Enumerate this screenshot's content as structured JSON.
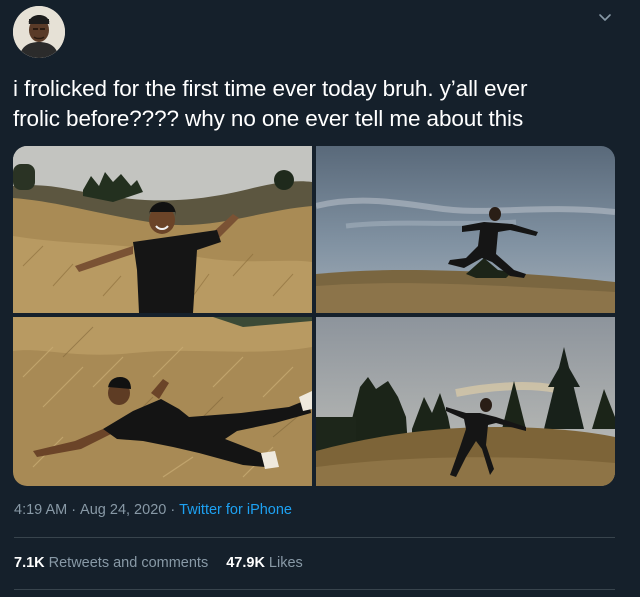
{
  "tweet": {
    "text_line1": "i frolicked for the first time ever today bruh. y’all ever",
    "text_line2": "frolic before???? why no one ever tell me about this",
    "time": "4:19 AM",
    "date": "Aug 24, 2020",
    "separator": "·",
    "source": "Twitter for iPhone"
  },
  "stats": {
    "retweets_count": "7.1K",
    "retweets_label": "Retweets and comments",
    "likes_count": "47.9K",
    "likes_label": "Likes"
  },
  "icons": {
    "menu": "chevron-down-icon",
    "avatar": "profile-avatar"
  },
  "colors": {
    "background": "#15202b",
    "text": "#ffffff",
    "secondary": "#8899a6",
    "link": "#1da1f2",
    "divider": "#38444d"
  }
}
